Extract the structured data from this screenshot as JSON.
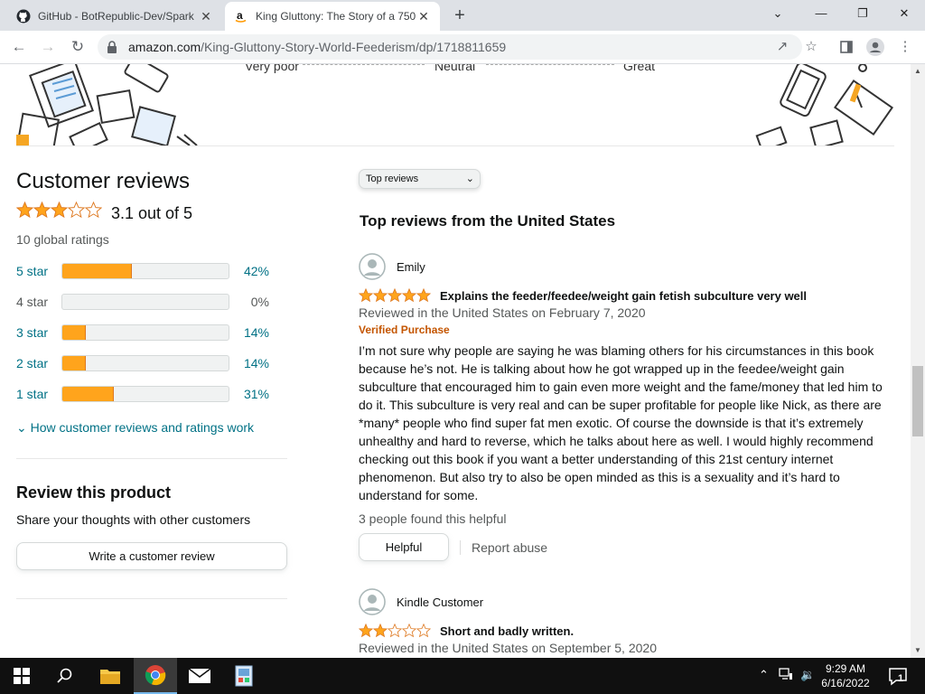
{
  "browser": {
    "tabs": [
      {
        "title": "GitHub - BotRepublic-Dev/Spark",
        "close": "✕"
      },
      {
        "title": "King Gluttony: The Story of a 750",
        "close": "✕"
      }
    ],
    "new_tab": "+",
    "window_controls": [
      "⌄",
      "—",
      "❐",
      "✕"
    ],
    "url_host": "amazon.com",
    "url_path": "/King-Gluttony-Story-World-Feederism/dp/1718811659"
  },
  "banner": {
    "scale_labels": [
      "Very poor",
      "Neutral",
      "Great"
    ]
  },
  "reviews_summary": {
    "heading": "Customer reviews",
    "average_rating": 3.1,
    "average_text": "3.1 out of 5",
    "global_ratings": "10 global ratings",
    "histogram": [
      {
        "label": "5 star",
        "percent": 42,
        "percent_text": "42%"
      },
      {
        "label": "4 star",
        "percent": 0,
        "percent_text": "0%"
      },
      {
        "label": "3 star",
        "percent": 14,
        "percent_text": "14%"
      },
      {
        "label": "2 star",
        "percent": 14,
        "percent_text": "14%"
      },
      {
        "label": "1 star",
        "percent": 31,
        "percent_text": "31%"
      }
    ],
    "how_link": "How customer reviews and ratings work"
  },
  "review_product": {
    "title": "Review this product",
    "subtitle": "Share your thoughts with other customers",
    "button": "Write a customer review"
  },
  "sort": {
    "selected": "Top reviews"
  },
  "top_reviews_title": "Top reviews from the United States",
  "reviews": [
    {
      "author": "Emily",
      "rating": 5,
      "title": "Explains the feeder/feedee/weight gain fetish subculture very well",
      "date": "Reviewed in the United States on February 7, 2020",
      "verified": "Verified Purchase",
      "body": "I’m not sure why people are saying he was blaming others for his circumstances in this book because he’s not. He is talking about how he got wrapped up in the feedee/weight gain subculture that encouraged him to gain even more weight and the fame/money that led him to do it. This subculture is very real and can be super profitable for people like Nick, as there are *many* people who find super fat men exotic. Of course the downside is that it’s extremely unhealthy and hard to reverse, which he talks about here as well. I would highly recommend checking out this book if you want a better understanding of this 21st century internet phenomenon. But also try to also be open minded as this is a sexuality and it’s hard to understand for some.",
      "helpful_count": "3 people found this helpful",
      "helpful_button": "Helpful",
      "report": "Report abuse"
    },
    {
      "author": "Kindle Customer",
      "rating": 2,
      "title": "Short and badly written.",
      "date": "Reviewed in the United States on September 5, 2020"
    }
  ],
  "taskbar": {
    "time": "9:29 AM",
    "date": "6/16/2022",
    "notification_count": "1",
    "apps": [
      "start-icon",
      "search-icon",
      "file-explorer-icon",
      "chrome-icon",
      "mail-icon",
      "paint-icon"
    ]
  },
  "colors": {
    "star": "#ffa41c",
    "link": "#007185",
    "verified": "#c45500",
    "bar_fill": "#ffa41c"
  }
}
